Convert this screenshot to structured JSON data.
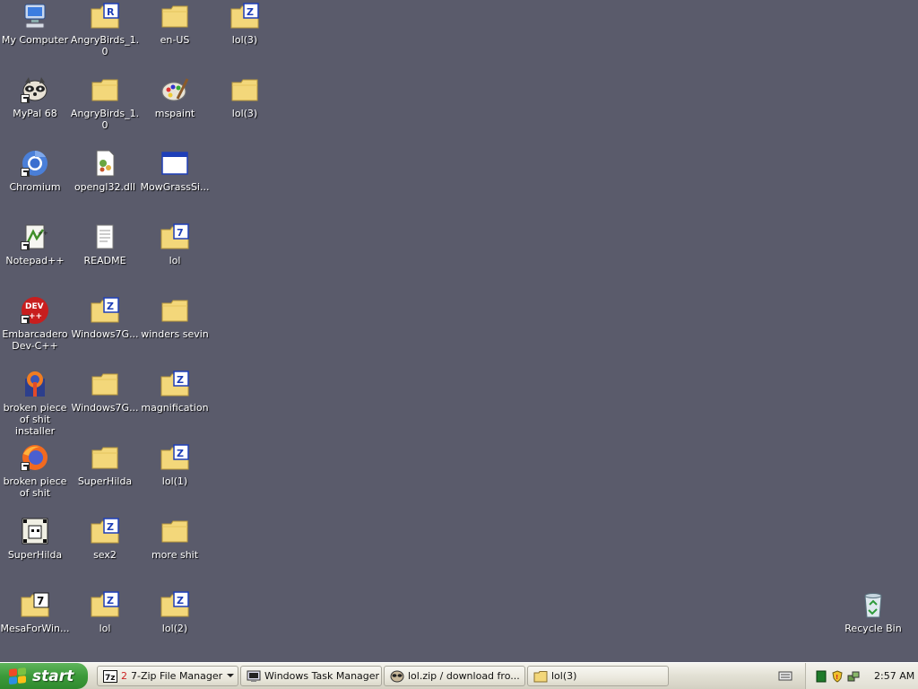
{
  "desktop": {
    "icons": [
      {
        "label": "My Computer",
        "icon": "my-computer-icon"
      },
      {
        "label": "AngryBirds_1.0",
        "icon": "rar-folder-icon"
      },
      {
        "label": "en-US",
        "icon": "folder-icon"
      },
      {
        "label": "lol(3)",
        "icon": "zip-folder-icon"
      },
      {
        "label": "MyPal 68",
        "icon": "mypal-icon"
      },
      {
        "label": "AngryBirds_1.0",
        "icon": "folder-icon"
      },
      {
        "label": "mspaint",
        "icon": "paint-icon"
      },
      {
        "label": "lol(3)",
        "icon": "folder-icon"
      },
      {
        "label": "Chromium",
        "icon": "chromium-icon"
      },
      {
        "label": "opengl32.dll",
        "icon": "dll-file-icon"
      },
      {
        "label": "MowGrassSi...",
        "icon": "window-app-icon"
      },
      {
        "label": "Notepad++",
        "icon": "notepadpp-icon"
      },
      {
        "label": "README",
        "icon": "text-file-icon"
      },
      {
        "label": "lol",
        "icon": "zip-folder-icon"
      },
      {
        "label": "Embarcadero Dev-C++",
        "icon": "devcpp-icon"
      },
      {
        "label": "Windows7G...",
        "icon": "zip-folder-icon"
      },
      {
        "label": "winders sevin",
        "icon": "folder-icon"
      },
      {
        "label": "broken piece of shit installer",
        "icon": "firefox-installer-icon"
      },
      {
        "label": "Windows7G...",
        "icon": "folder-icon"
      },
      {
        "label": "magnification",
        "icon": "zip-folder-icon"
      },
      {
        "label": "broken piece of shit",
        "icon": "firefox-icon"
      },
      {
        "label": "SuperHilda",
        "icon": "folder-icon"
      },
      {
        "label": "lol(1)",
        "icon": "zip-folder-icon"
      },
      {
        "label": "SuperHilda",
        "icon": "superhilda-icon"
      },
      {
        "label": "sex2",
        "icon": "zip-folder-icon"
      },
      {
        "label": "more shit",
        "icon": "folder-icon"
      },
      {
        "label": "MesaForWin...",
        "icon": "7z-folder-icon"
      },
      {
        "label": "lol",
        "icon": "zip-folder-icon"
      },
      {
        "label": "lol(2)",
        "icon": "zip-folder-icon"
      },
      {
        "label": "Recycle Bin",
        "icon": "recycle-bin-icon"
      }
    ]
  },
  "taskbar": {
    "start_label": "start",
    "tasks": [
      {
        "label": "7-Zip File Manager",
        "prefix": "2",
        "icon": "7zip-icon"
      },
      {
        "label": "Windows Task Manager",
        "icon": "task-manager-icon"
      },
      {
        "label": "lol.zip / download fro...",
        "icon": "mypal-icon"
      },
      {
        "label": "lol(3)",
        "icon": "folder-icon"
      }
    ],
    "clock": "2:57 AM"
  },
  "colors": {
    "desktop_bg": "#5a5b6b",
    "start_green": "#3c9a3a",
    "folder_yellow": "#f3d77a",
    "zip_blue": "#1e3fb8"
  }
}
